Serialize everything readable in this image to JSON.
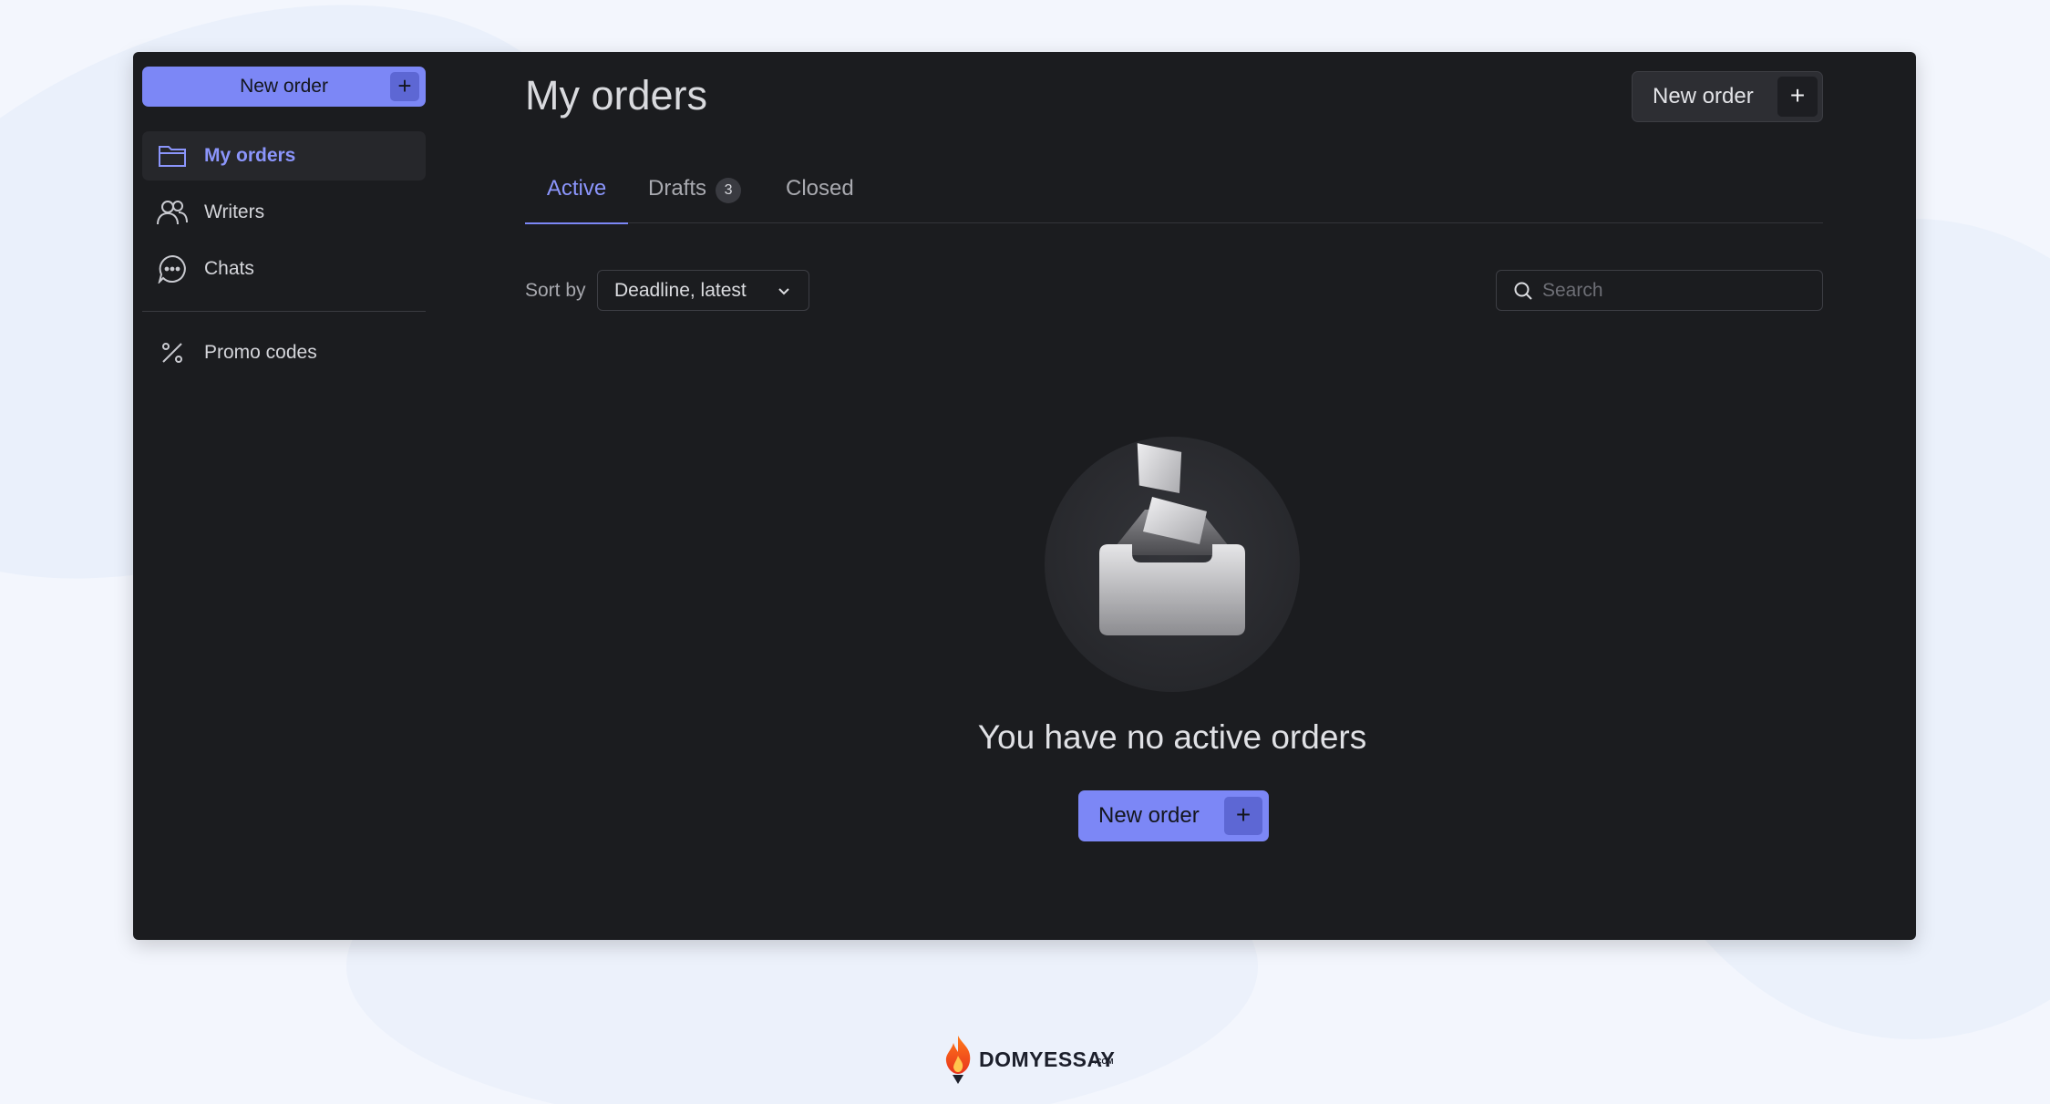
{
  "sidebar": {
    "new_order_label": "New order",
    "plus_symbol": "+",
    "items": [
      {
        "label": "My orders",
        "icon": "folder-icon",
        "active": true
      },
      {
        "label": "Writers",
        "icon": "users-icon",
        "active": false
      },
      {
        "label": "Chats",
        "icon": "chat-icon",
        "active": false
      },
      {
        "label": "Promo codes",
        "icon": "percent-icon",
        "active": false
      }
    ]
  },
  "header": {
    "title": "My orders",
    "new_order_label": "New order",
    "plus_symbol": "+"
  },
  "tabs": [
    {
      "label": "Active",
      "active": true
    },
    {
      "label": "Drafts",
      "badge": "3",
      "active": false
    },
    {
      "label": "Closed",
      "active": false
    }
  ],
  "filters": {
    "sort_label": "Sort by",
    "sort_value": "Deadline, latest",
    "search_placeholder": "Search",
    "search_value": ""
  },
  "empty_state": {
    "title": "You have no active orders",
    "button_label": "New order",
    "plus_symbol": "+",
    "illustration": "empty-inbox-icon"
  },
  "footer": {
    "brand_name": "DOMYESSAY",
    "brand_suffix": ".COM"
  },
  "colors": {
    "accent": "#7c87f6",
    "accent_dark": "#5d67d4",
    "active_text": "#8b95fb",
    "app_bg": "#1b1c1f",
    "page_bg": "#f3f6fd"
  }
}
